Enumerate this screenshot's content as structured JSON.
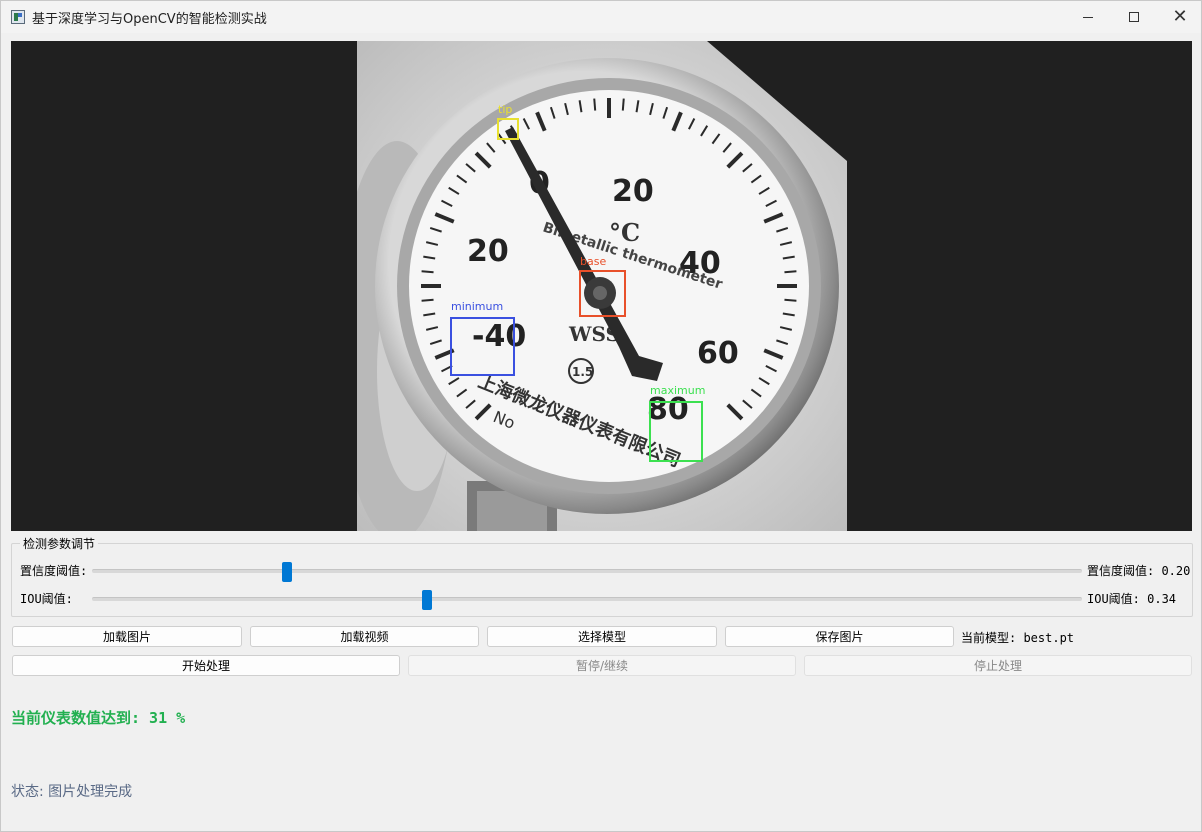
{
  "window": {
    "title": "基于深度学习与OpenCV的智能检测实战",
    "minimize_icon": "minimize-icon",
    "maximize_icon": "maximize-icon",
    "close_icon": "close-icon"
  },
  "display": {
    "dial_numbers": [
      "0",
      "20",
      "20",
      "40",
      "-40",
      "60",
      "80"
    ],
    "unit": "°C",
    "brand_text": "Bimetallic thermometer",
    "logo_text": "WSS",
    "class_mark": "1.5",
    "maker_text": "上海微龙仪器仪表有限公司",
    "serial_prefix": "No",
    "detections": [
      {
        "label": "tip",
        "color": "#e8e030"
      },
      {
        "label": "base",
        "color": "#e8502a"
      },
      {
        "label": "minimum",
        "color": "#3a50e0"
      },
      {
        "label": "maximum",
        "color": "#3ce050"
      }
    ]
  },
  "params": {
    "group_title": "检测参数调节",
    "confidence": {
      "label": "置信度阈值:",
      "value_text": "置信度阈值: 0.20",
      "value": 0.2
    },
    "iou": {
      "label": "IOU阈值:",
      "value_text": "IOU阈值: 0.34",
      "value": 0.34
    }
  },
  "buttons": {
    "load_image": "加载图片",
    "load_video": "加载视频",
    "select_model": "选择模型",
    "save_image": "保存图片",
    "start": "开始处理",
    "pause": "暂停/继续",
    "stop": "停止处理"
  },
  "current_model": "当前模型: best.pt",
  "reading": "当前仪表数值达到: 31 %",
  "status": "状态: 图片处理完成"
}
